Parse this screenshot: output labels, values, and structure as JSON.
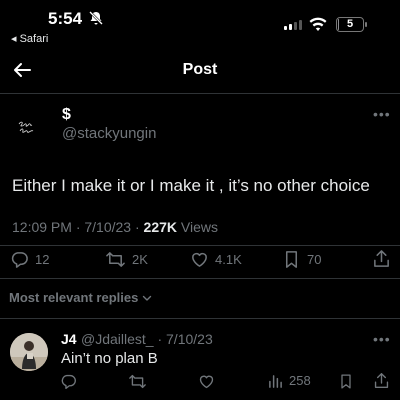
{
  "status_bar": {
    "time": "5:54",
    "back_app": "◂ Safari",
    "battery": "5",
    "battery_level_percent": 5
  },
  "header": {
    "title": "Post"
  },
  "tweet": {
    "display_name": "$",
    "username": "@stackyungin",
    "text": "Either I make it or I make it , it’s no other choice",
    "time": "12:09 PM · 7/10/23 · ",
    "views_count": "227K",
    "views_label": " Views",
    "replies": "12",
    "retweets": "2K",
    "likes": "4.1K",
    "bookmarks": "70"
  },
  "replies_filter": "Most relevant replies",
  "reply": {
    "name": "J4",
    "handle": "@Jdaillest_ · 7/10/23",
    "text": "Ain’t no plan B",
    "views": "258"
  },
  "colors": {
    "background": "#000000",
    "text": "#e7e9ea",
    "muted": "#71767b",
    "divider": "#2f3336"
  }
}
